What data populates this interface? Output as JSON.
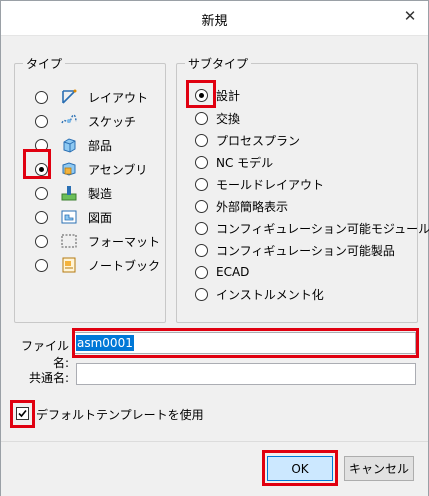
{
  "dialog": {
    "title": "新規",
    "close_glyph": "✕"
  },
  "type_group": {
    "legend": "タイプ",
    "selected": "アセンブリ",
    "items": [
      {
        "label": "レイアウト",
        "icon": "layout-icon",
        "selected": false
      },
      {
        "label": "スケッチ",
        "icon": "sketch-icon",
        "selected": false
      },
      {
        "label": "部品",
        "icon": "part-icon",
        "selected": false
      },
      {
        "label": "アセンブリ",
        "icon": "assembly-icon",
        "selected": true
      },
      {
        "label": "製造",
        "icon": "manufacturing-icon",
        "selected": false
      },
      {
        "label": "図面",
        "icon": "drawing-icon",
        "selected": false
      },
      {
        "label": "フォーマット",
        "icon": "format-icon",
        "selected": false
      },
      {
        "label": "ノートブック",
        "icon": "notebook-icon",
        "selected": false
      }
    ]
  },
  "subtype_group": {
    "legend": "サブタイプ",
    "selected": "設計",
    "items": [
      {
        "label": "設計",
        "selected": true
      },
      {
        "label": "交換",
        "selected": false
      },
      {
        "label": "プロセスプラン",
        "selected": false
      },
      {
        "label": "NC モデル",
        "selected": false
      },
      {
        "label": "モールドレイアウト",
        "selected": false
      },
      {
        "label": "外部簡略表示",
        "selected": false
      },
      {
        "label": "コンフィギュレーション可能モジュール",
        "selected": false
      },
      {
        "label": "コンフィギュレーション可能製品",
        "selected": false
      },
      {
        "label": "ECAD",
        "selected": false
      },
      {
        "label": "インストルメント化",
        "selected": false
      }
    ]
  },
  "file_name": {
    "label": "ファイル名:",
    "value": "asm0001"
  },
  "common_name": {
    "label": "共通名:",
    "value": ""
  },
  "default_template": {
    "label": "デフォルトテンプレートを使用",
    "checked": true
  },
  "buttons": {
    "ok": "OK",
    "cancel": "キャンセル"
  },
  "colors": {
    "highlight": "#e00010",
    "ok_button": "#cce8ff",
    "selection": "#0078d7"
  }
}
